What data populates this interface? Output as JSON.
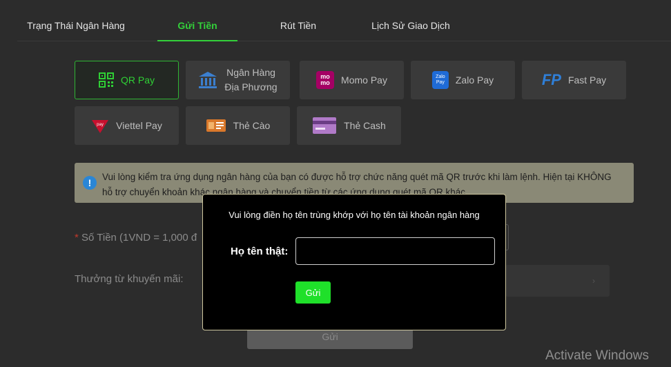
{
  "tabs": [
    {
      "label": "Trạng Thái Ngân Hàng"
    },
    {
      "label": "Gửi Tiền"
    },
    {
      "label": "Rút Tiền"
    },
    {
      "label": "Lịch Sử Giao Dịch"
    }
  ],
  "payment_methods": [
    {
      "label": "QR Pay",
      "icon": "qr-code-icon"
    },
    {
      "label_line1": "Ngân Hàng",
      "label_line2": "Địa Phương",
      "icon": "bank-icon"
    },
    {
      "label": "Momo Pay",
      "icon": "momo-icon"
    },
    {
      "label": "Zalo Pay",
      "icon": "zalopay-icon"
    },
    {
      "label": "Fast Pay",
      "icon": "fastpay-icon"
    },
    {
      "label": "Viettel Pay",
      "icon": "viettelpay-icon"
    },
    {
      "label": "Thẻ Cào",
      "icon": "scratch-card-icon"
    },
    {
      "label": "Thẻ Cash",
      "icon": "cash-card-icon"
    }
  ],
  "notice": {
    "icon": "info-icon",
    "line1": "Vui lòng kiểm tra ứng dụng ngân hàng của bạn có được hỗ trợ chức năng quét mã QR trước khi làm lệnh. Hiện tại KHÔNG",
    "line2": "hỗ trợ chuyển khoản khác ngân hàng và chuyển tiền từ các ứng dụng quét mã QR khác."
  },
  "form": {
    "amount_label": "Số Tiền (1VND = 1,000 đ",
    "promo_label": "Thưởng từ khuyến mãi:",
    "submit_label": "Gửi"
  },
  "modal": {
    "title": "Vui lòng điền họ tên trùng khớp với họ tên tài khoản ngân hàng",
    "name_label": "Họ tên thật:",
    "name_value": "",
    "submit_label": "Gửi"
  },
  "watermark": "Activate Windows",
  "colors": {
    "accent": "#33d13a",
    "button": "#1fe02a",
    "info": "#2a86d6"
  }
}
